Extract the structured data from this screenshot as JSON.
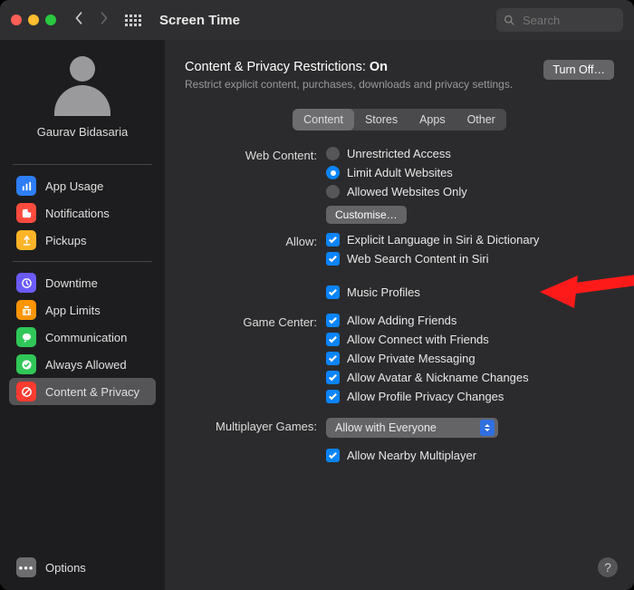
{
  "toolbar": {
    "title": "Screen Time",
    "search_placeholder": "Search"
  },
  "sidebar": {
    "username": "Gaurav Bidasaria",
    "group1": [
      {
        "label": "App Usage"
      },
      {
        "label": "Notifications"
      },
      {
        "label": "Pickups"
      }
    ],
    "group2": [
      {
        "label": "Downtime"
      },
      {
        "label": "App Limits"
      },
      {
        "label": "Communication"
      },
      {
        "label": "Always Allowed"
      },
      {
        "label": "Content & Privacy"
      }
    ],
    "options_label": "Options"
  },
  "header": {
    "title_prefix": "Content & Privacy Restrictions: ",
    "title_state": "On",
    "subtitle": "Restrict explicit content, purchases, downloads and privacy settings.",
    "turn_off": "Turn Off…"
  },
  "tabs": [
    "Content",
    "Stores",
    "Apps",
    "Other"
  ],
  "labels": {
    "web_content": "Web Content:",
    "allow": "Allow:",
    "game_center": "Game Center:",
    "multiplayer": "Multiplayer Games:"
  },
  "web_content": {
    "options": [
      "Unrestricted Access",
      "Limit Adult Websites",
      "Allowed Websites Only"
    ],
    "selected": 1,
    "customise": "Customise…"
  },
  "allow": [
    "Explicit Language in Siri & Dictionary",
    "Web Search Content in Siri",
    "Music Profiles"
  ],
  "game_center": [
    "Allow Adding Friends",
    "Allow Connect with Friends",
    "Allow Private Messaging",
    "Allow Avatar & Nickname Changes",
    "Allow Profile Privacy Changes"
  ],
  "multiplayer": {
    "value": "Allow with Everyone",
    "nearby": "Allow Nearby Multiplayer"
  }
}
